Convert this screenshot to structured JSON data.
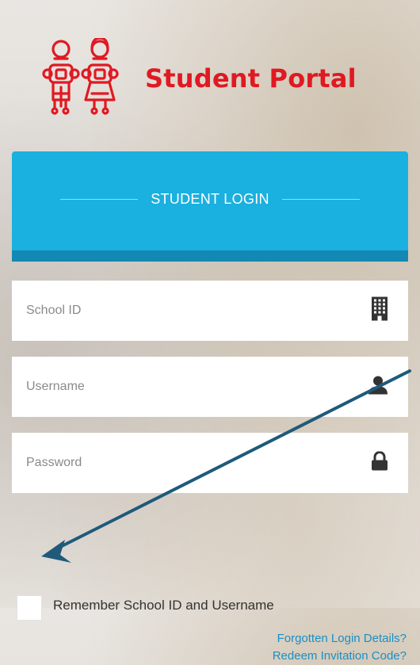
{
  "brand": {
    "title": "Student Portal"
  },
  "login": {
    "title": "STUDENT LOGIN",
    "school_id": {
      "placeholder": "School ID",
      "value": ""
    },
    "username": {
      "placeholder": "Username",
      "value": ""
    },
    "password": {
      "placeholder": "Password",
      "value": ""
    },
    "remember_label": "Remember School ID and Username",
    "remember_checked": false,
    "links": {
      "forgotten": "Forgotten Login Details?",
      "redeem": "Redeem Invitation Code?"
    }
  },
  "colors": {
    "brand_red": "#e01922",
    "header_blue": "#1ab0df",
    "header_dark_blue": "#1288b3",
    "link_blue": "#1a8fc4",
    "annotation_arrow": "#1f5a7a"
  },
  "icons": {
    "school_id": "building-icon",
    "username": "user-icon",
    "password": "lock-icon",
    "logo": "students-logo-icon"
  }
}
